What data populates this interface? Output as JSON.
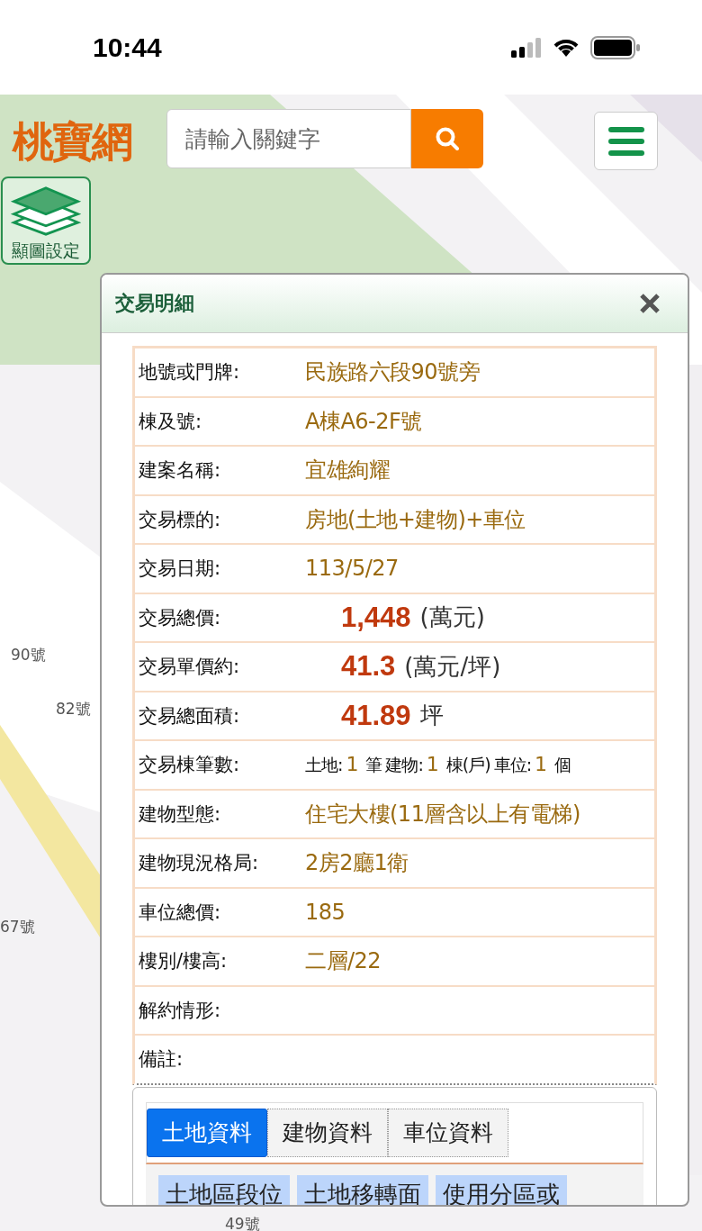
{
  "status_bar": {
    "time": "10:44"
  },
  "header": {
    "logo": "桃寶網",
    "search": {
      "placeholder": "請輸入關鍵字"
    }
  },
  "layer_button": {
    "label": "顯圖設定"
  },
  "map_labels": [
    "90號",
    "82號",
    "67號",
    "49號"
  ],
  "dialog": {
    "title": "交易明細",
    "rows": [
      {
        "kind": "text",
        "label": "地號或門牌:",
        "value": "民族路六段90號旁"
      },
      {
        "kind": "text",
        "label": "棟及號:",
        "value": "A棟A6-2F號"
      },
      {
        "kind": "text",
        "label": "建案名稱:",
        "value": "宜雄絢耀"
      },
      {
        "kind": "text",
        "label": "交易標的:",
        "value": "房地(土地+建物)+車位"
      },
      {
        "kind": "text",
        "label": "交易日期:",
        "value": "113/5/27"
      },
      {
        "kind": "price",
        "label": "交易總價:",
        "value": "1,448",
        "unit": "(萬元)"
      },
      {
        "kind": "price",
        "label": "交易單價約:",
        "value": "41.3",
        "unit": "(萬元/坪)"
      },
      {
        "kind": "price",
        "label": "交易總面積:",
        "value": "41.89",
        "unit": "坪"
      },
      {
        "kind": "counts",
        "label": "交易棟筆數:",
        "parts": [
          {
            "name": "土地:",
            "count": "1",
            "unit": "筆"
          },
          {
            "name": "建物:",
            "count": "1",
            "unit": "棟(戶)"
          },
          {
            "name": "車位:",
            "count": "1",
            "unit": "個"
          }
        ]
      },
      {
        "kind": "text",
        "label": "建物型態:",
        "value": "住宅大樓(11層含以上有電梯)"
      },
      {
        "kind": "text",
        "label": "建物現況格局:",
        "value": "2房2廳1衛"
      },
      {
        "kind": "text",
        "label": "車位總價:",
        "value": "185"
      },
      {
        "kind": "text",
        "label": "樓別/樓高:",
        "value": "二層/22"
      },
      {
        "kind": "text",
        "label": "解約情形:"
      },
      {
        "kind": "text",
        "label": "備註:"
      }
    ],
    "tabs": [
      {
        "label": "土地資料",
        "selected": true
      },
      {
        "label": "建物資料",
        "selected": false
      },
      {
        "label": "車位資料",
        "selected": false
      }
    ],
    "columns": [
      "土地區段位",
      "土地移轉面",
      "使用分區或"
    ]
  }
}
